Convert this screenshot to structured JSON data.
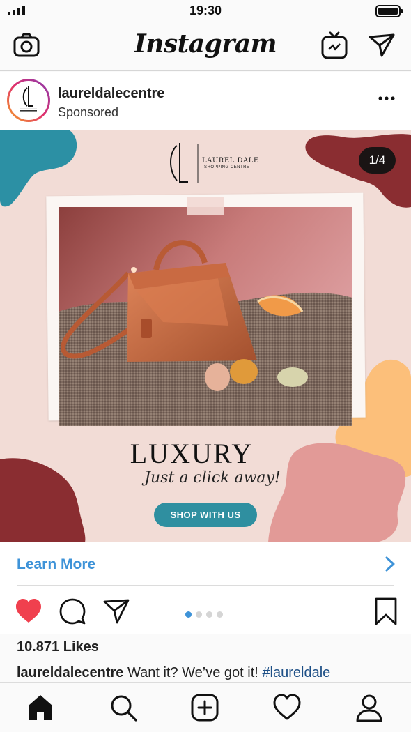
{
  "status_bar": {
    "time": "19:30"
  },
  "app": {
    "wordmark": "Instagram"
  },
  "post": {
    "username": "laureldalecentre",
    "sponsored_label": "Sponsored",
    "avatar_text": "LAUREL DALE"
  },
  "ad": {
    "counter": "1/4",
    "brand_name": "LAUREL DALE",
    "brand_subtitle": "SHOPPING CENTRE",
    "headline": "LUXURY",
    "tagline": "Just a click away!",
    "cta_label": "SHOP WITH US"
  },
  "learn_more": {
    "label": "Learn More"
  },
  "actions": {
    "carousel_total": 4,
    "carousel_active": 1
  },
  "likes": "10.871 Likes",
  "caption": {
    "username": "laureldalecentre",
    "text": "Want it? We’ve got it!",
    "hashtag": "#laureldale"
  },
  "colors": {
    "accent_blue": "#3e93d8",
    "heart_red": "#f0404e",
    "cta_teal": "#2f8fa0",
    "ad_background": "#f2dcd6"
  },
  "icons": [
    "signal-icon",
    "battery-icon",
    "camera-icon",
    "igtv-icon",
    "direct-send-icon",
    "more-icon",
    "chevron-right-icon",
    "heart-icon",
    "comment-icon",
    "share-icon",
    "bookmark-icon",
    "home-icon",
    "search-icon",
    "add-icon",
    "activity-heart-icon",
    "profile-icon"
  ]
}
